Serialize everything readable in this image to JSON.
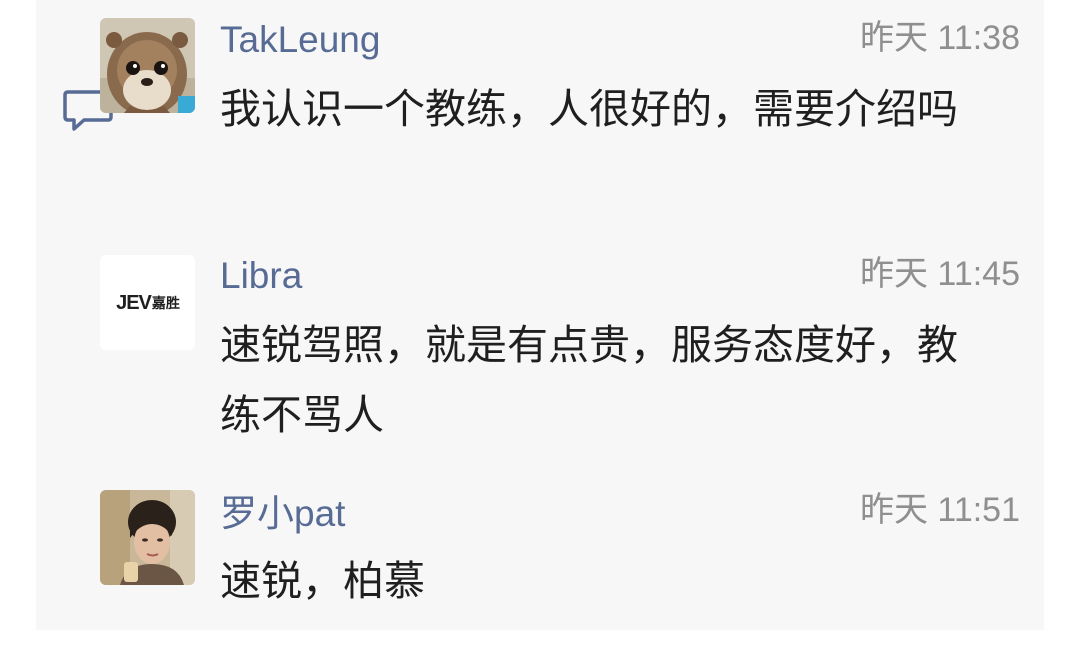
{
  "icons": {
    "comment": "comment-bubble-icon"
  },
  "colors": {
    "name": "#576b95",
    "time": "#8f8f8f",
    "text": "#1f1f1f",
    "panel": "#f7f7f7"
  },
  "comments": [
    {
      "name": "TakLeung",
      "time": "昨天 11:38",
      "text": "我认识一个教练，人很好的，需要介绍吗"
    },
    {
      "name": "Libra",
      "time": "昨天 11:45",
      "text": "速锐驾照，就是有点贵，服务态度好，教练不骂人",
      "avatar_logo": {
        "brand": "JEV",
        "tagline": "嘉胜"
      }
    },
    {
      "name": "罗小pat",
      "time": "昨天 11:51",
      "text": "速锐，柏慕"
    }
  ]
}
